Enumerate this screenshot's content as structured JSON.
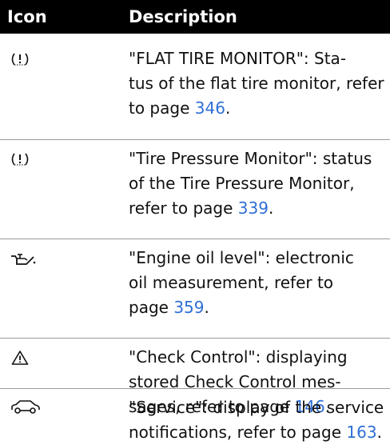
{
  "table": {
    "headers": {
      "icon": "Icon",
      "description": "Description"
    },
    "rows": [
      {
        "icon": "tire-pressure-warning-icon",
        "text": "\"FLAT TIRE MONITOR\": Sta-\ntus of the flat tire monitor, refer\nto page ",
        "page": "346",
        "end": "."
      },
      {
        "icon": "tire-pressure-warning-icon",
        "text": "\"Tire Pressure Monitor\": status\nof the Tire Pressure Monitor,\nrefer to page ",
        "page": "339",
        "end": "."
      },
      {
        "icon": "oil-can-icon",
        "text": "\"Engine oil level\": electronic\noil measurement, refer to\npage ",
        "page": "359",
        "end": "."
      },
      {
        "icon": "warning-triangle-icon",
        "text": "\"Check Control\": displaying\nstored Check Control mes-\nsages, refer to page ",
        "page": "146",
        "end": "."
      },
      {
        "icon": "car-service-icon",
        "text": "\"Service\": display of the service\nnotifications, refer to page ",
        "page": "163",
        "end": "."
      }
    ]
  }
}
